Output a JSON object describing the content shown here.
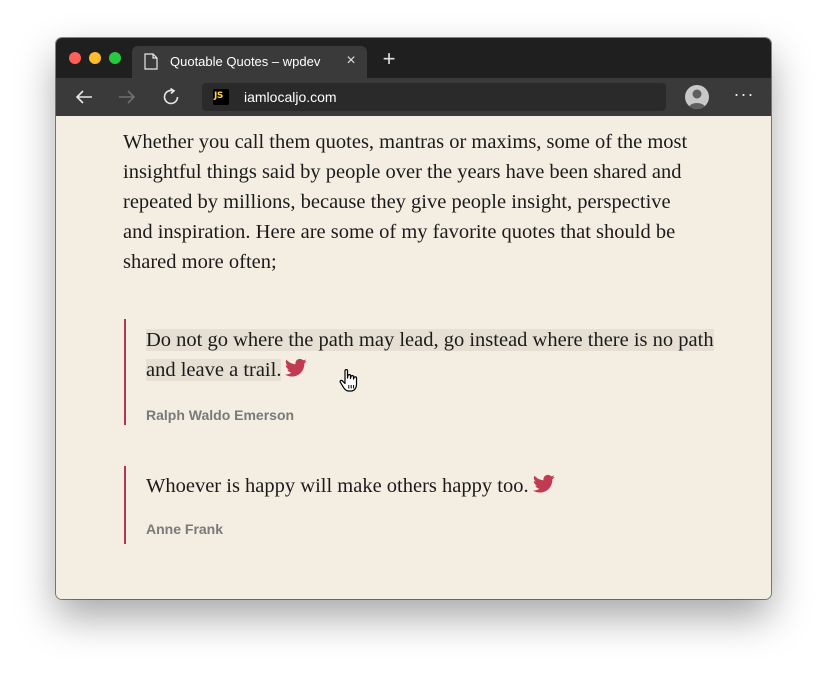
{
  "browser": {
    "tab_title": "Quotable Quotes – wpdev",
    "tab_close": "×",
    "new_tab": "+",
    "url": "iamlocaljo.com",
    "favicon_text": "JS",
    "more_menu": "···"
  },
  "page": {
    "intro": "Whether you call them quotes, mantras or maxims, some of the most insightful things said by people over the years have been shared and repeated by millions, because they give people insight, perspective and inspiration. Here are some of my favorite quotes that should be shared more often;",
    "quotes": [
      {
        "text": "Do not go where the path may lead, go instead where there is no path and leave a trail.",
        "author": "Ralph Waldo Emerson",
        "icon": "twitter-icon"
      },
      {
        "text": "Whoever is happy will make others happy too.",
        "author": "Anne Frank",
        "icon": "twitter-icon"
      }
    ]
  },
  "colors": {
    "page_background": "#f3ede2",
    "accent": "#b5354c",
    "highlight": "#e5e0d3",
    "tab_bar": "#1f1f1f",
    "toolbar": "#3a3a3a"
  }
}
